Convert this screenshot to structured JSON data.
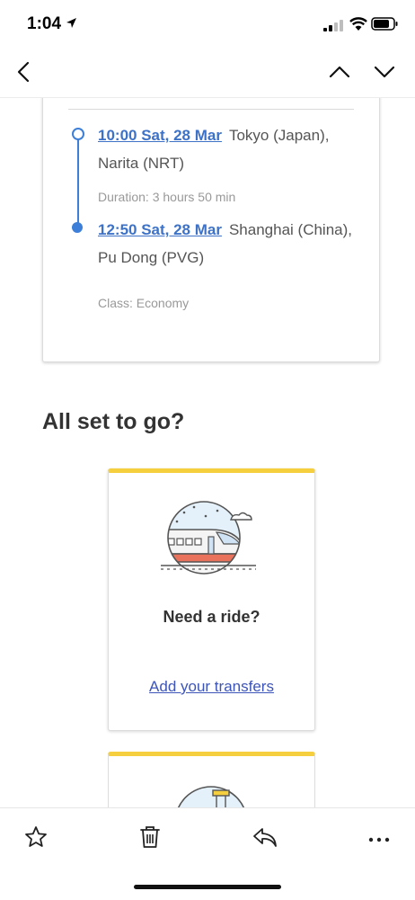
{
  "status_bar": {
    "time": "1:04"
  },
  "navigation": {
    "back_icon": "chevron-left-icon",
    "prev_icon": "chevron-up-icon",
    "next_icon": "chevron-down-icon"
  },
  "flight": {
    "departure": {
      "time": "10:00 Sat, 28 Mar",
      "place": "Tokyo (Japan), Narita (NRT)"
    },
    "duration": "Duration: 3 hours 50 min",
    "arrival": {
      "time": "12:50 Sat, 28 Mar",
      "place": "Shanghai (China), Pu Dong (PVG)"
    },
    "class": "Class: Economy"
  },
  "section": {
    "title": "All set to go?"
  },
  "ride_card": {
    "title": "Need a ride?",
    "link": "Add your transfers",
    "accent_color": "#f5cf3d"
  },
  "toolbar": {
    "icons": [
      "star-icon",
      "trash-icon",
      "reply-icon",
      "more-icon"
    ]
  },
  "colors": {
    "link_blue": "#3d72c7",
    "timeline_blue": "#3d7fd8",
    "transfers_link": "#3d55b8"
  }
}
